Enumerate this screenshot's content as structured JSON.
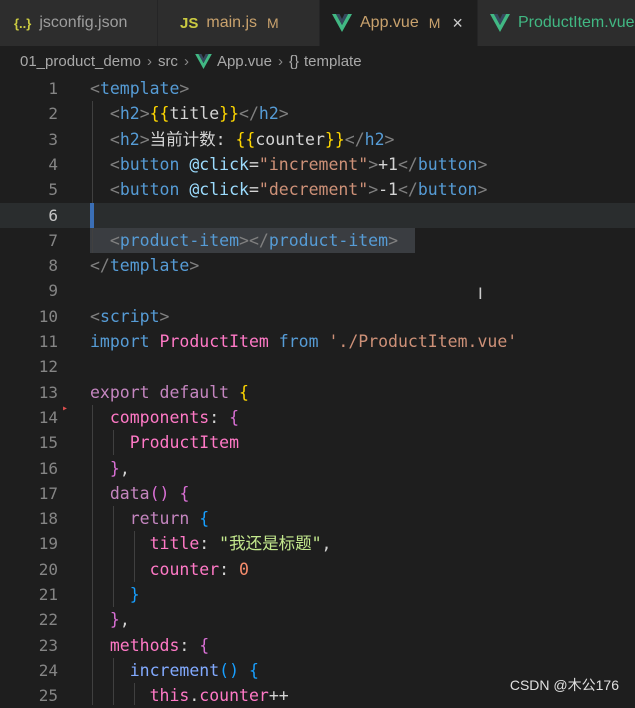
{
  "tabs": [
    {
      "icon": "{..}",
      "label": "jsconfig.json",
      "mod": "",
      "active": false
    },
    {
      "icon": "JS",
      "label": "main.js",
      "mod": "M",
      "active": false
    },
    {
      "icon": "vue",
      "label": "App.vue",
      "mod": "M",
      "active": true,
      "close": "×"
    },
    {
      "icon": "vue",
      "label": "ProductItem.vue",
      "mod": "",
      "active": false
    }
  ],
  "breadcrumb": {
    "folder": "01_product_demo",
    "sub": "src",
    "file": "App.vue",
    "symbol_icon": "{}",
    "symbol": "template"
  },
  "editor": {
    "cursor_line": 6,
    "line_numbers": [
      "1",
      "2",
      "3",
      "4",
      "5",
      "6",
      "7",
      "8",
      "9",
      "10",
      "11",
      "12",
      "13",
      "14",
      "15",
      "16",
      "17",
      "18",
      "19",
      "20",
      "21",
      "22",
      "23",
      "24",
      "25"
    ],
    "code": {
      "l1": "<template>",
      "l2": "<h2>{{title}}</h2>",
      "l3_text": "当前计数: ",
      "l3_var": "counter",
      "l4_attr": "@click",
      "l4_val": "\"increment\"",
      "l4_text": "+1",
      "l5_attr": "@click",
      "l5_val": "\"decrement\"",
      "l5_text": "-1",
      "l7_tag": "product-item",
      "l8": "</template>",
      "l10": "<script>",
      "l11_kw": "import",
      "l11_name": "ProductItem",
      "l11_from": "from",
      "l11_path": "'./ProductItem.vue'",
      "l13_kw1": "export",
      "l13_kw2": "default",
      "l14_key": "components",
      "l15_name": "ProductItem",
      "l17_fn": "data",
      "l18_kw": "return",
      "l19_key": "title",
      "l19_val": "\"我还是标题\"",
      "l20_key": "counter",
      "l20_val": "0",
      "l23_key": "methods",
      "l24_fn": "increment",
      "l25_this": "this",
      "l25_prop": "counter",
      "l25_op": "++"
    }
  },
  "watermark": "CSDN @木公176",
  "colors": {
    "background": "#1e1e1e",
    "tab_active": "#1e1e1e",
    "tab_inactive": "#2d2d2d",
    "vue_green": "#41b883",
    "js_yellow": "#cbcb41"
  },
  "icons": [
    "json-icon",
    "js-icon",
    "vue-icon",
    "close-icon",
    "chevron-right-icon",
    "curly-braces-icon",
    "text-cursor-icon"
  ]
}
